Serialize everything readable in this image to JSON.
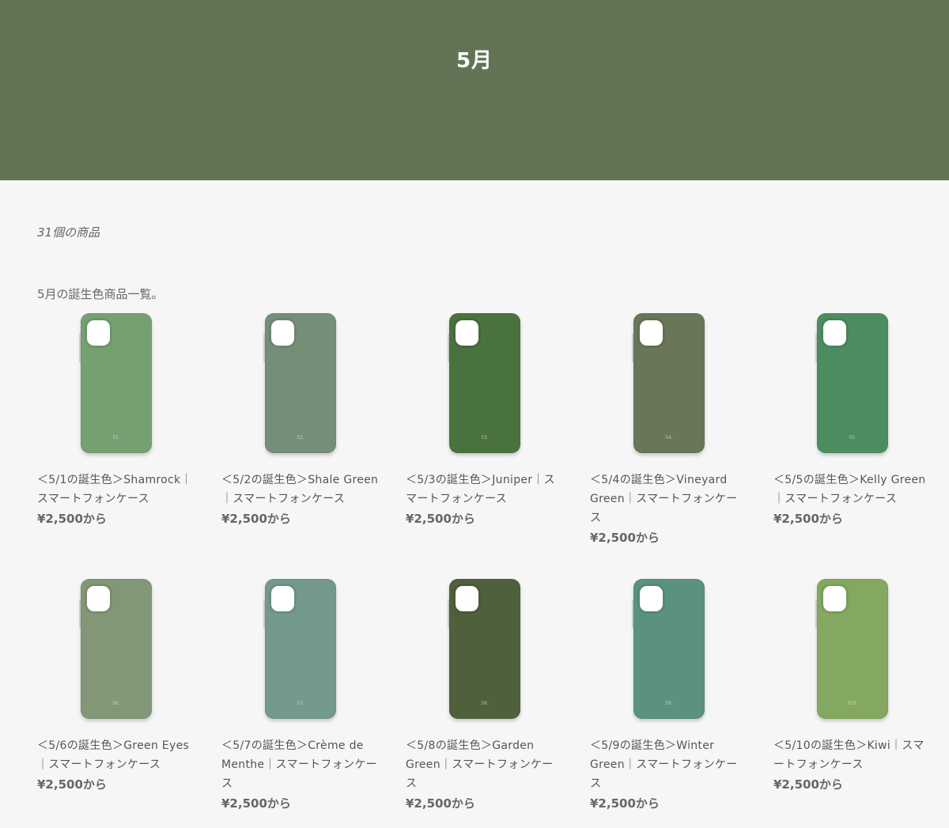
{
  "header": {
    "title": "5月"
  },
  "collection": {
    "count_text": "31個の商品",
    "description": "5月の誕生色商品一覧。"
  },
  "products": [
    {
      "title": "＜5/1の誕生色＞Shamrock｜スマートフォンケース",
      "price": "¥2,500から",
      "case_label": "51.",
      "color": "#75a071"
    },
    {
      "title": "＜5/2の誕生色＞Shale Green｜スマートフォンケース",
      "price": "¥2,500から",
      "case_label": "52.",
      "color": "#768e77"
    },
    {
      "title": "＜5/3の誕生色＞Juniper｜スマートフォンケース",
      "price": "¥2,500から",
      "case_label": "53.",
      "color": "#4a723e"
    },
    {
      "title": "＜5/4の誕生色＞Vineyard Green｜スマートフォンケース",
      "price": "¥2,500から",
      "case_label": "54.",
      "color": "#6a7658"
    },
    {
      "title": "＜5/5の誕生色＞Kelly Green｜スマートフォンケース",
      "price": "¥2,500から",
      "case_label": "55.",
      "color": "#4d8c60"
    },
    {
      "title": "＜5/6の誕生色＞Green Eyes｜スマートフォンケース",
      "price": "¥2,500から",
      "case_label": "56.",
      "color": "#829777"
    },
    {
      "title": "＜5/7の誕生色＞Crème de Menthe｜スマートフォンケース",
      "price": "¥2,500から",
      "case_label": "57.",
      "color": "#73998e"
    },
    {
      "title": "＜5/8の誕生色＞Garden Green｜スマートフォンケース",
      "price": "¥2,500から",
      "case_label": "58.",
      "color": "#4f603c"
    },
    {
      "title": "＜5/9の誕生色＞Winter Green｜スマートフォンケース",
      "price": "¥2,500から",
      "case_label": "59.",
      "color": "#5a927f"
    },
    {
      "title": "＜5/10の誕生色＞Kiwi｜スマートフォンケース",
      "price": "¥2,500から",
      "case_label": "510.",
      "color": "#84a85f"
    }
  ]
}
